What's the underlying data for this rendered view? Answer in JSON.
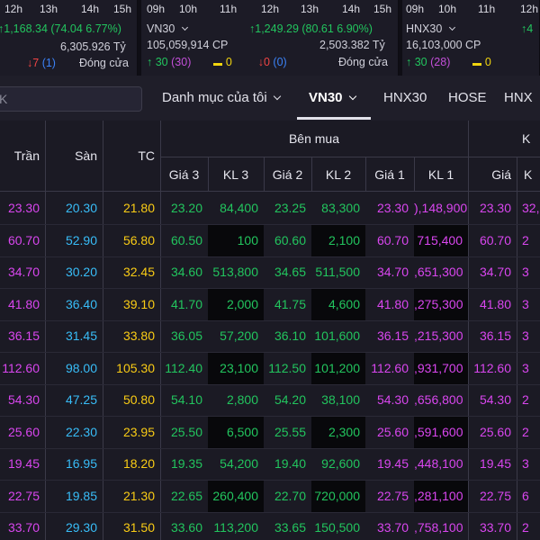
{
  "index_cards": [
    {
      "times": [
        "12h",
        "13h",
        "14h",
        "15h"
      ],
      "change": "1,168.34 (74.04 6.77%)",
      "value": "6,305.926 Tỷ",
      "decliners": "7",
      "unchanged": "(1)",
      "status": "Đóng cửa"
    },
    {
      "times": [
        "09h",
        "10h",
        "11h",
        "12h",
        "13h",
        "14h",
        "15h"
      ],
      "name": "VN30",
      "change": "1,249.29 (80.61 6.90%)",
      "volume": "105,059,914 CP",
      "value": "2,503.382 Tỷ",
      "advancers": "30",
      "ceiling": "(30)",
      "unchanged": "0",
      "decliners": "0",
      "floor": "(0)",
      "status": "Đóng cửa"
    },
    {
      "times": [
        "09h",
        "10h",
        "11h",
        "12h"
      ],
      "name": "HNX30",
      "change": "4",
      "volume": "16,103,000 CP",
      "advancers": "30",
      "ceiling": "(28)",
      "unchanged": "0"
    }
  ],
  "toolbar": {
    "search_placeholder": "K",
    "watchlist": "Danh mục của tôi",
    "vn30": "VN30",
    "hnx30": "HNX30",
    "hose": "HOSE",
    "hnx": "HNX"
  },
  "table": {
    "headers": {
      "tran": "Trần",
      "san": "Sàn",
      "tc": "TC",
      "buy_group": "Bên mua",
      "sell_group": "K",
      "gia3": "Giá 3",
      "kl3": "KL 3",
      "gia2": "Giá 2",
      "kl2": "KL 2",
      "gia1": "Giá 1",
      "kl1": "KL 1",
      "gia": "Giá",
      "next": "K"
    },
    "rows": [
      [
        "23.30",
        "20.30",
        "21.80",
        "23.20",
        "84,400",
        "23.25",
        "83,300",
        "23.30",
        "),148,900",
        "23.30",
        "32,"
      ],
      [
        "60.70",
        "52.90",
        "56.80",
        "60.50",
        "100",
        "60.60",
        "2,100",
        "60.70",
        "715,400",
        "60.70",
        "2"
      ],
      [
        "34.70",
        "30.20",
        "32.45",
        "34.60",
        "513,800",
        "34.65",
        "511,500",
        "34.70",
        ",651,300",
        "34.70",
        "3"
      ],
      [
        "41.80",
        "36.40",
        "39.10",
        "41.70",
        "2,000",
        "41.75",
        "4,600",
        "41.80",
        ",275,300",
        "41.80",
        "3"
      ],
      [
        "36.15",
        "31.45",
        "33.80",
        "36.05",
        "57,200",
        "36.10",
        "101,600",
        "36.15",
        ",215,300",
        "36.15",
        "3"
      ],
      [
        "112.60",
        "98.00",
        "105.30",
        "112.40",
        "23,100",
        "112.50",
        "101,200",
        "112.60",
        ",931,700",
        "112.60",
        "3"
      ],
      [
        "54.30",
        "47.25",
        "50.80",
        "54.10",
        "2,800",
        "54.20",
        "38,100",
        "54.30",
        ",656,800",
        "54.30",
        "2"
      ],
      [
        "25.60",
        "22.30",
        "23.95",
        "25.50",
        "6,500",
        "25.55",
        "2,300",
        "25.60",
        ",591,600",
        "25.60",
        "2"
      ],
      [
        "19.45",
        "16.95",
        "18.20",
        "19.35",
        "54,200",
        "19.40",
        "92,600",
        "19.45",
        ",448,100",
        "19.45",
        "3"
      ],
      [
        "22.75",
        "19.85",
        "21.30",
        "22.65",
        "260,400",
        "22.70",
        "720,000",
        "22.75",
        ",281,100",
        "22.75",
        "6"
      ],
      [
        "33.70",
        "29.30",
        "31.50",
        "33.60",
        "113,200",
        "33.65",
        "150,500",
        "33.70",
        ",758,100",
        "33.70",
        "2"
      ]
    ]
  },
  "colors": {
    "up": "#22c55e",
    "down": "#ef4444",
    "ceiling": "#d946ef",
    "floor": "#38bdf8",
    "reference": "#facc15"
  }
}
